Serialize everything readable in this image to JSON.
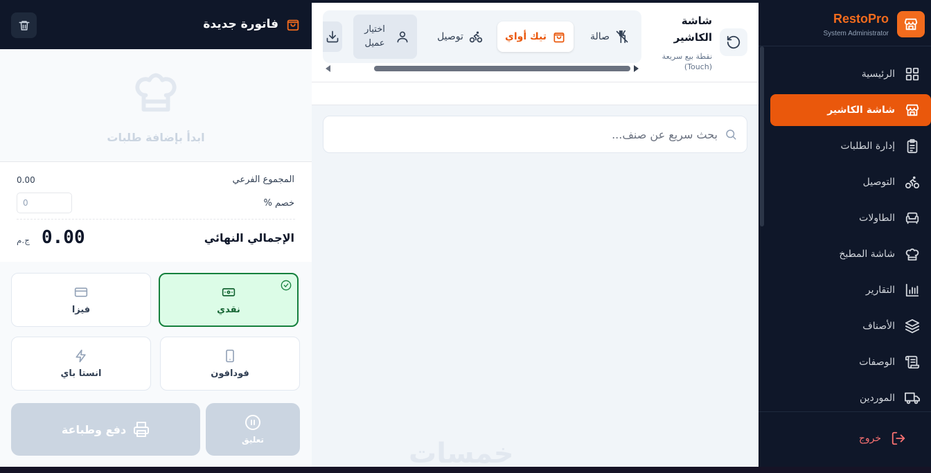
{
  "sidebar": {
    "brand_name": "RestoPro",
    "brand_sub": "System Administrator",
    "items": [
      {
        "label": "الرئيسية",
        "icon": "dashboard-icon"
      },
      {
        "label": "شاشة الكاشير",
        "icon": "store-icon",
        "active": true
      },
      {
        "label": "إدارة الطلبات",
        "icon": "clipboard-icon"
      },
      {
        "label": "التوصيل",
        "icon": "bicycle-icon"
      },
      {
        "label": "الطاولات",
        "icon": "armchair-icon"
      },
      {
        "label": "شاشة المطبخ",
        "icon": "chef-hat-icon"
      },
      {
        "label": "التقارير",
        "icon": "bar-chart-icon"
      },
      {
        "label": "الأصناف",
        "icon": "layers-icon"
      },
      {
        "label": "الوصفات",
        "icon": "scroll-icon"
      },
      {
        "label": "الموردين",
        "icon": "truck-icon"
      }
    ],
    "logout_label": "خروج"
  },
  "header": {
    "title": "شاشة الكاشير",
    "subtitle": "نقطة بيع سريعة (Touch)",
    "tabs": [
      {
        "label": "صالة",
        "icon": "utensils-off-icon"
      },
      {
        "label": "تيك أواي",
        "icon": "shopping-bag-icon",
        "active": true
      },
      {
        "label": "توصيل",
        "icon": "bicycle-icon"
      }
    ],
    "customer_label": "اختيار عميل"
  },
  "search": {
    "placeholder": "بحث سريع عن صنف..."
  },
  "invoice": {
    "title": "فاتورة جديدة",
    "empty_text": "ابدأ بإضافة طلبات",
    "subtotal_label": "المجموع الفرعي",
    "subtotal_value": "0.00",
    "discount_label": "% خصم",
    "discount_value": "0",
    "total_label": "الإجمالي النهائي",
    "total_value": "0.00",
    "currency": "ج.م",
    "payment_methods": [
      {
        "label": "نقدي",
        "icon": "banknote-icon",
        "selected": true
      },
      {
        "label": "فيزا",
        "icon": "credit-card-icon"
      },
      {
        "label": "فودافون",
        "icon": "smartphone-icon"
      },
      {
        "label": "انستا باي",
        "icon": "zap-icon"
      }
    ],
    "suspend_label": "تعليق",
    "pay_print_label": "دفع وطباعة"
  },
  "watermark": "خمسات",
  "colors": {
    "accent": "#ea580c",
    "sidebar_bg": "#0f1729",
    "selected_green": "#15803d",
    "disabled_button": "#cbd5e1"
  }
}
